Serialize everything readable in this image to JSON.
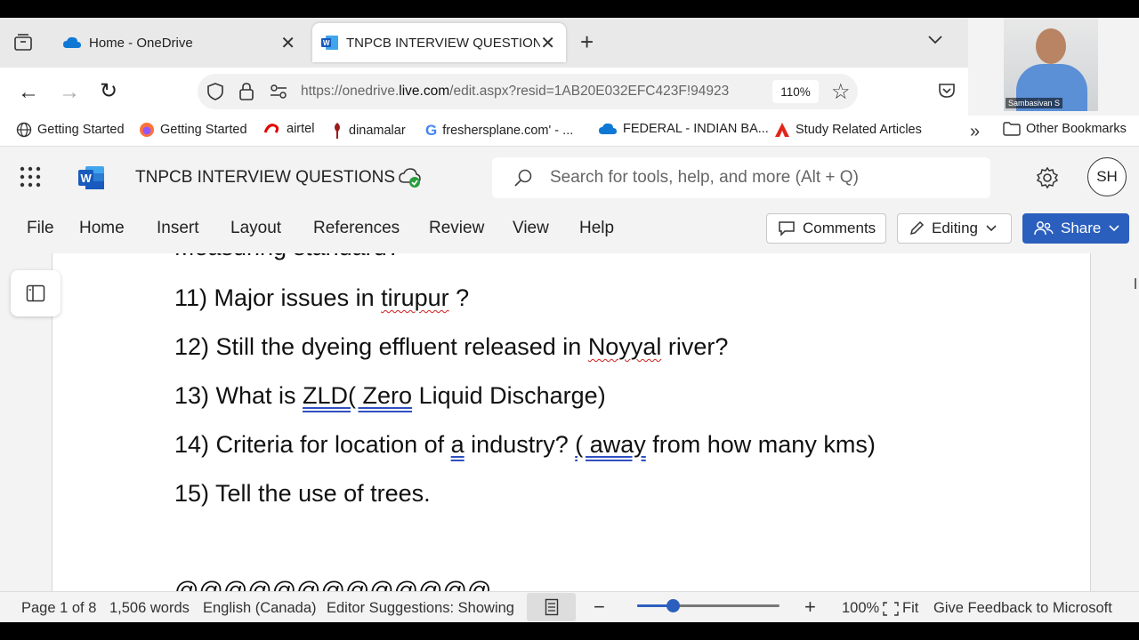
{
  "browser": {
    "tabs": [
      {
        "title": "Home - OneDrive"
      },
      {
        "title": "TNPCB INTERVIEW QUESTIONS.d"
      }
    ],
    "url_prefix": "https://onedrive.",
    "url_domain": "live.com",
    "url_path": "/edit.aspx?resid=1AB20E032EFC423F!94923",
    "zoom": "110%",
    "bookmarks": [
      {
        "label": "Getting Started",
        "icon": "globe-icon"
      },
      {
        "label": "Getting Started",
        "icon": "firefox-icon"
      },
      {
        "label": "airtel",
        "icon": "airtel-icon"
      },
      {
        "label": "dinamalar",
        "icon": "dinamalar-icon"
      },
      {
        "label": "freshersplane.com' - ...",
        "icon": "google-icon"
      },
      {
        "label": "FEDERAL - INDIAN BA...",
        "icon": "onedrive-icon"
      },
      {
        "label": "Study Related Articles",
        "icon": "adobe-icon"
      }
    ],
    "other_bookmarks": "Other Bookmarks"
  },
  "video": {
    "participant_name": "Sambasivan S"
  },
  "word": {
    "doc_title": "TNPCB INTERVIEW QUESTIONS",
    "search_placeholder": "Search for tools, help, and more (Alt + Q)",
    "avatar_initials": "SH",
    "menu": [
      "File",
      "Home",
      "Insert",
      "Layout",
      "References",
      "Review",
      "View",
      "Help"
    ],
    "comments_label": "Comments",
    "editing_label": "Editing",
    "share_label": "Share",
    "accent": "#2b5fbe"
  },
  "document": {
    "partial_top": "Measuring standard?",
    "q11": {
      "pre": "11) Major issues in ",
      "sq": "tirupur",
      "post": " ?"
    },
    "q12": {
      "pre": "12) Still the dyeing effluent released in ",
      "sq": "Noyyal",
      "post": " river?"
    },
    "q13": {
      "pre": "13) What is ",
      "gr": "ZLD( Zero",
      "post": " Liquid Discharge)"
    },
    "q14": {
      "pre": "14) Criteria for location of ",
      "gr1": "a",
      "mid": " industry? ",
      "gr2": "( away",
      "post": " from how many kms)"
    },
    "q15": "15) Tell the use of trees.",
    "partial_bottom": "@@@@@@@@@@@@@"
  },
  "status": {
    "page": "Page 1 of 8",
    "words": "1,506 words",
    "language": "English (Canada)",
    "editor": "Editor Suggestions: Showing",
    "zoom_level": 0.25,
    "zoom": "100%",
    "fit": "Fit",
    "feedback": "Give Feedback to Microsoft"
  }
}
